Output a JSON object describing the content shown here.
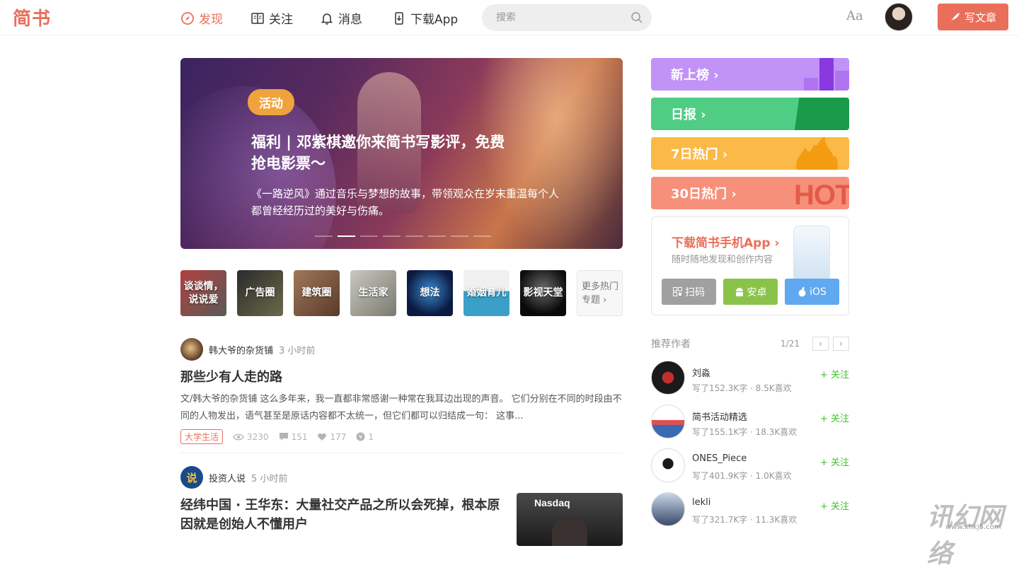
{
  "nav": {
    "logo": "简书",
    "items": [
      {
        "label": "发现",
        "icon": "compass-icon",
        "active": true
      },
      {
        "label": "关注",
        "icon": "book-icon",
        "active": false
      },
      {
        "label": "消息",
        "icon": "bell-icon",
        "active": false
      },
      {
        "label": "下载App",
        "icon": "phone-icon",
        "active": false
      }
    ],
    "search_placeholder": "搜索",
    "font_setting": "Aa",
    "write_label": "写文章"
  },
  "banner": {
    "tag": "活动",
    "title": "福利 | 邓紫棋邀你来简书写影评，免费抢电影票～",
    "subtitle": "《一路逆风》通过音乐与梦想的故事，带领观众在岁末重温每个人都曾经经历过的美好与伤痛。",
    "slide_count": 8,
    "active_slide": 2
  },
  "topics": [
    {
      "label": "谈谈情，说说爱"
    },
    {
      "label": "广告圈"
    },
    {
      "label": "建筑圈"
    },
    {
      "label": "生活家"
    },
    {
      "label": "想法"
    },
    {
      "label": "婚姻育儿"
    },
    {
      "label": "影视天堂"
    },
    {
      "label": "更多热门专题 ›"
    }
  ],
  "articles": [
    {
      "author": "韩大爷的杂货铺",
      "time": "3 小时前",
      "title": "那些少有人走的路",
      "abstract": "文/韩大爷的杂货铺 这么多年来，我一直都非常感谢一种常在我耳边出现的声音。 它们分别在不同的时段由不同的人物发出，语气甚至是原话内容都不太统一，但它们都可以归结成一句： 这事...",
      "tag": "大学生活",
      "views": "3230",
      "comments": "151",
      "likes": "177",
      "rewards": "1"
    },
    {
      "author": "投资人说",
      "time": "5 小时前",
      "title": "经纬中国 · 王华东：大量社交产品之所以会死掉，根本原因就是创始人不懂用户",
      "thumb_text": "Nasdaq"
    }
  ],
  "boards": [
    {
      "label": "新上榜 ›",
      "color": "#c293f7"
    },
    {
      "label": "日报 ›",
      "color": "#4fcd85"
    },
    {
      "label": "7日热门 ›",
      "color": "#fbb947"
    },
    {
      "label": "30日热门 ›",
      "color": "#f7907a",
      "badge": "HOT"
    }
  ],
  "download": {
    "title": "下载简书手机App ›",
    "subtitle": "随时随地发现和创作内容",
    "buttons": [
      {
        "label": "扫码",
        "color": "#a0a0a0"
      },
      {
        "label": "安卓",
        "color": "#8bc34a"
      },
      {
        "label": "iOS",
        "color": "#60a8ef"
      }
    ]
  },
  "recommend": {
    "title": "推荐作者",
    "page": "1/21",
    "follow_label": "+ 关注",
    "authors": [
      {
        "name": "刘淼",
        "stats": "写了152.3K字 · 8.5K喜欢"
      },
      {
        "name": "简书活动精选",
        "stats": "写了155.1K字 · 18.3K喜欢"
      },
      {
        "name": "ONES_Piece",
        "stats": "写了401.9K字 · 1.0K喜欢"
      },
      {
        "name": "lekli",
        "stats": "写了321.7K字 · 11.3K喜欢"
      }
    ]
  },
  "watermark": {
    "text": "讯幻网络",
    "site": "www.xhkj5.com"
  }
}
